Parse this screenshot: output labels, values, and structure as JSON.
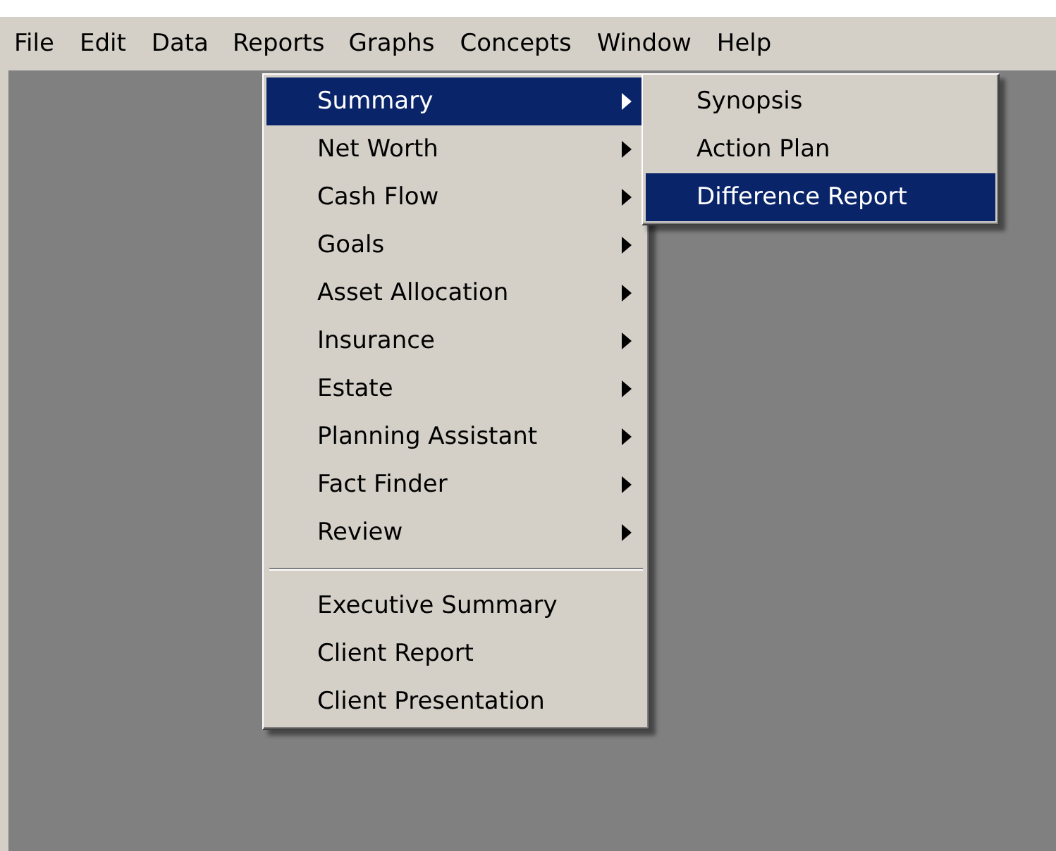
{
  "menu_bar": [
    {
      "label": "File",
      "selected": false
    },
    {
      "label": "Edit",
      "selected": false
    },
    {
      "label": "Data",
      "selected": false
    },
    {
      "label": "Reports",
      "selected": true
    },
    {
      "label": "Graphs",
      "selected": false
    },
    {
      "label": "Concepts",
      "selected": false
    },
    {
      "label": "Window",
      "selected": false
    },
    {
      "label": "Help",
      "selected": false
    }
  ],
  "reports_menu": {
    "items": [
      {
        "kind": "item",
        "label": "Summary",
        "has_submenu": true,
        "selected": true
      },
      {
        "kind": "item",
        "label": "Net Worth",
        "has_submenu": true,
        "selected": false
      },
      {
        "kind": "item",
        "label": "Cash Flow",
        "has_submenu": true,
        "selected": false
      },
      {
        "kind": "item",
        "label": "Goals",
        "has_submenu": true,
        "selected": false
      },
      {
        "kind": "item",
        "label": "Asset Allocation",
        "has_submenu": true,
        "selected": false
      },
      {
        "kind": "item",
        "label": "Insurance",
        "has_submenu": true,
        "selected": false
      },
      {
        "kind": "item",
        "label": "Estate",
        "has_submenu": true,
        "selected": false
      },
      {
        "kind": "item",
        "label": "Planning Assistant",
        "has_submenu": true,
        "selected": false
      },
      {
        "kind": "item",
        "label": "Fact Finder",
        "has_submenu": true,
        "selected": false
      },
      {
        "kind": "item",
        "label": "Review",
        "has_submenu": true,
        "selected": false
      },
      {
        "kind": "separator"
      },
      {
        "kind": "item",
        "label": "Executive Summary",
        "has_submenu": false,
        "selected": false
      },
      {
        "kind": "item",
        "label": "Client Report",
        "has_submenu": false,
        "selected": false
      },
      {
        "kind": "item",
        "label": "Client Presentation",
        "has_submenu": false,
        "selected": false
      }
    ]
  },
  "summary_submenu": {
    "items": [
      {
        "kind": "item",
        "label": "Synopsis",
        "has_submenu": false,
        "selected": false
      },
      {
        "kind": "item",
        "label": "Action Plan",
        "has_submenu": false,
        "selected": false
      },
      {
        "kind": "item",
        "label": "Difference Report",
        "has_submenu": false,
        "selected": true
      }
    ]
  }
}
